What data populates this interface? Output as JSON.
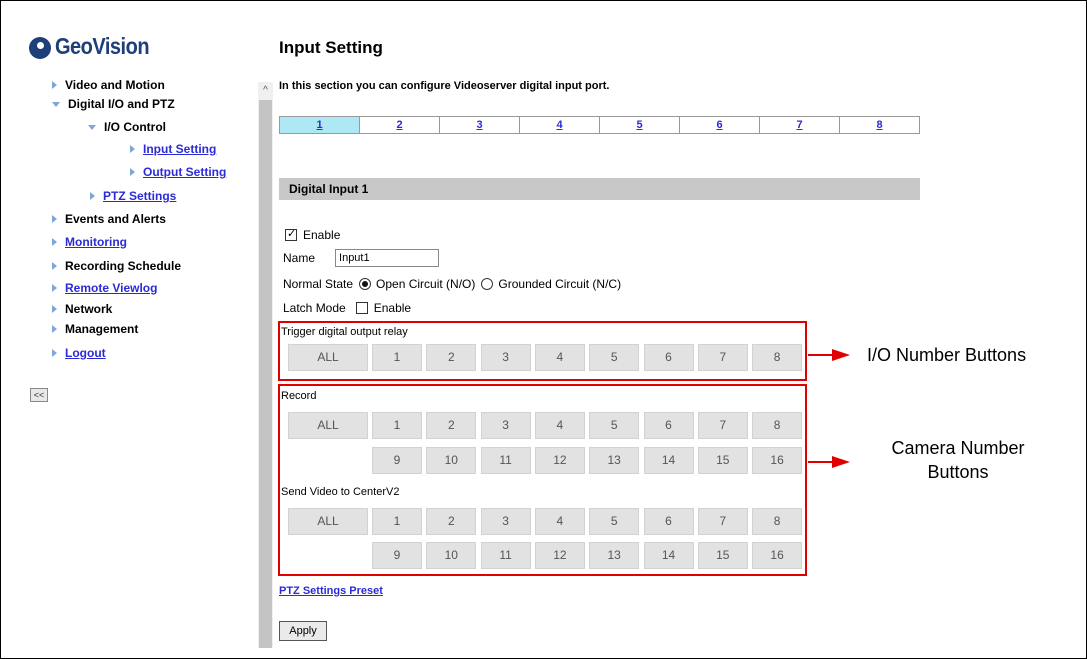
{
  "brand": {
    "logo_text": "GeoVision"
  },
  "sidebar": {
    "items": [
      {
        "label": "Video and Motion",
        "link": false
      },
      {
        "label": "Digital I/O and PTZ",
        "link": false
      },
      {
        "label": "I/O Control",
        "link": false
      },
      {
        "label": "Input Setting",
        "link": true
      },
      {
        "label": "Output Setting",
        "link": true
      },
      {
        "label": "PTZ Settings",
        "link": true
      },
      {
        "label": "Events and Alerts",
        "link": false
      },
      {
        "label": "Monitoring",
        "link": true
      },
      {
        "label": "Recording Schedule",
        "link": false
      },
      {
        "label": "Remote Viewlog",
        "link": true
      },
      {
        "label": "Network",
        "link": false
      },
      {
        "label": "Management",
        "link": false
      },
      {
        "label": "Logout",
        "link": true
      }
    ],
    "collapse_label": "<<"
  },
  "main": {
    "title": "Input Setting",
    "intro": "In this section you can configure Videoserver digital input port.",
    "tabs": [
      "1",
      "2",
      "3",
      "4",
      "5",
      "6",
      "7",
      "8"
    ],
    "active_tab": "1",
    "section_title": "Digital Input 1",
    "enable_label": "Enable",
    "enable_checked": true,
    "name_label": "Name",
    "name_value": "Input1",
    "normal_state_label": "Normal State",
    "normal_state_options": [
      "Open Circuit (N/O)",
      "Grounded Circuit (N/C)"
    ],
    "normal_state_selected": "Open Circuit (N/O)",
    "latch_label": "Latch Mode",
    "latch_enable_label": "Enable",
    "latch_checked": false,
    "trigger_label": "Trigger digital output relay",
    "record_label": "Record",
    "send_label": "Send Video to CenterV2",
    "all_label": "ALL",
    "row1_numbers": [
      "1",
      "2",
      "3",
      "4",
      "5",
      "6",
      "7",
      "8"
    ],
    "row2_numbers": [
      "9",
      "10",
      "11",
      "12",
      "13",
      "14",
      "15",
      "16"
    ],
    "ptz_preset_link": "PTZ Settings Preset",
    "apply_label": "Apply"
  },
  "annotations": {
    "io_buttons": "I/O Number Buttons",
    "camera_buttons_line1": "Camera Number",
    "camera_buttons_line2": "Buttons"
  },
  "colors": {
    "accent_red": "#e00000",
    "link_blue": "#2b2bd6",
    "active_tab": "#aee8f5",
    "brand_blue": "#1f3f7a"
  }
}
